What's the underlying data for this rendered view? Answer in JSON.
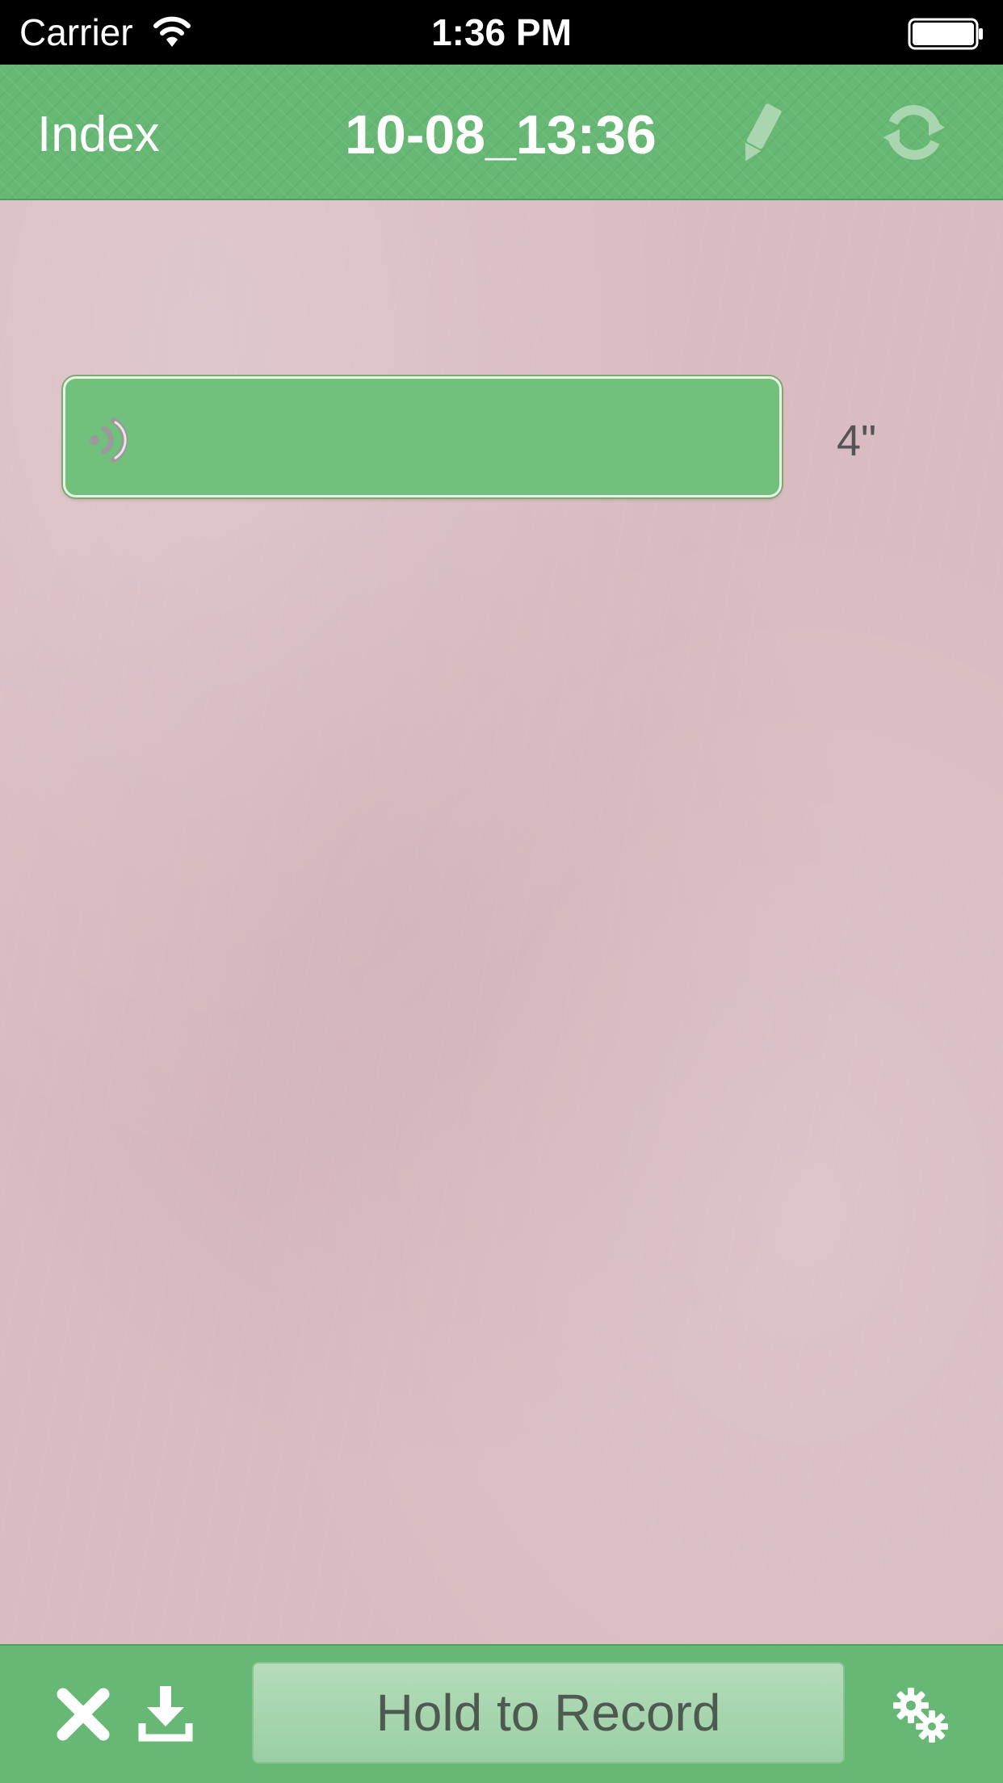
{
  "status_bar": {
    "carrier": "Carrier",
    "time": "1:36 PM",
    "icons": [
      "wifi-icon",
      "battery-icon"
    ]
  },
  "nav": {
    "back_label": "Index",
    "title": "10-08_13:36",
    "icons": [
      "pencil-icon",
      "refresh-icon"
    ]
  },
  "messages": [
    {
      "type": "voice",
      "duration": "4\"",
      "icon": "speaker-icon"
    }
  ],
  "toolbar": {
    "record_label": "Hold to Record",
    "icons": [
      "delete-icon",
      "download-icon",
      "settings-icon"
    ]
  },
  "colors": {
    "accent": "#67b874",
    "bubble": "#71c07c",
    "background": "#d8bcc1"
  }
}
